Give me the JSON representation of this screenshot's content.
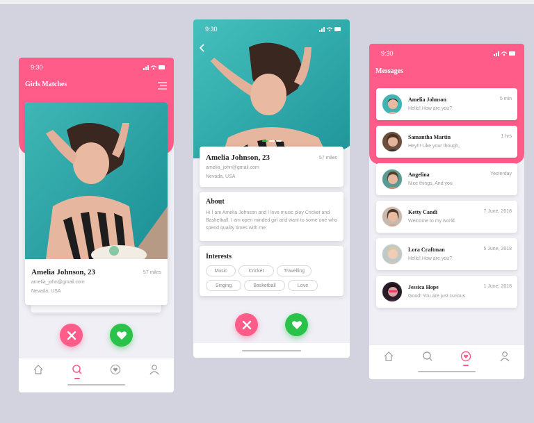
{
  "colors": {
    "accent": "#ff5c8a",
    "like": "#2bc24a",
    "background": "#d2d3de"
  },
  "status_time": "9:30",
  "screen1": {
    "title": "Girls Matches",
    "menu_icon": "hamburger-icon",
    "profile": {
      "name": "Amelia Johnson, 23",
      "email": "amelia_john@gmail.com",
      "location": "Nevada, USA",
      "distance": "57 miles"
    },
    "nav_icons": [
      "home-icon",
      "search-icon",
      "heart-chat-icon",
      "user-icon"
    ]
  },
  "screen2": {
    "back_icon": "chevron-left-icon",
    "profile": {
      "name": "Amelia Johnson, 23",
      "email": "amelia_john@gmail.com",
      "location": "Nevada, USA",
      "distance": "57 miles"
    },
    "about": {
      "heading": "About",
      "text": "Hi I am Amelia Johnson and I love music play Cricket and Basketball. I am open minded girl and want to some one who spend quality times with me."
    },
    "interests": {
      "heading": "Interests",
      "tags": [
        "Music",
        "Cricket",
        "Travelling",
        "Singing",
        "Basketball",
        "Love"
      ]
    }
  },
  "screen3": {
    "title": "Messages",
    "messages": [
      {
        "name": "Amelia Johnson",
        "text": "Hello! How are you?",
        "time": "5 min"
      },
      {
        "name": "Samantha Martin",
        "text": "Hey!!! Like your though,",
        "time": "1 hrs"
      },
      {
        "name": "Angelina",
        "text": "Nice things, And you",
        "time": "Yesterday"
      },
      {
        "name": "Ketty Candi",
        "text": "Welcome to my world.",
        "time": "7 June, 2018"
      },
      {
        "name": "Lora Craftman",
        "text": "Hello! How are you?",
        "time": "5 June, 2018"
      },
      {
        "name": "Jessica Hope",
        "text": "Good! You are just curious",
        "time": "1 June, 2018"
      }
    ],
    "nav_icons": [
      "home-icon",
      "search-icon",
      "heart-chat-icon",
      "user-icon"
    ]
  }
}
